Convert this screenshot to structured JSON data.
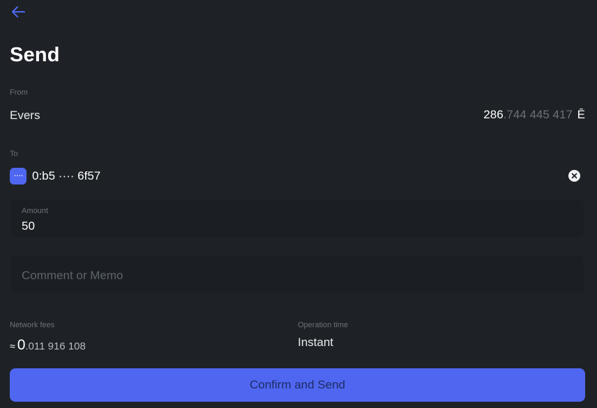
{
  "header": {
    "back_icon": "arrow-left-icon",
    "title": "Send"
  },
  "from": {
    "label": "From",
    "account": "Evers",
    "balance_int": "286",
    "balance_dec": ".744 445 417",
    "currency": "Ē"
  },
  "to": {
    "label": "To",
    "badge": "····",
    "address": "0:b5 ···· 6f57",
    "clear_icon": "close-circle-icon"
  },
  "amount": {
    "label": "Amount",
    "value": "50"
  },
  "comment": {
    "placeholder": "Comment or Memo"
  },
  "fees": {
    "label": "Network fees",
    "approx": "≈",
    "int": "0",
    "dec": ".011 916 108"
  },
  "operation": {
    "label": "Operation time",
    "value": "Instant"
  },
  "confirm_button": {
    "label": "Confirm and Send"
  },
  "colors": {
    "accent": "#4f67f0",
    "background": "#1e2226"
  }
}
